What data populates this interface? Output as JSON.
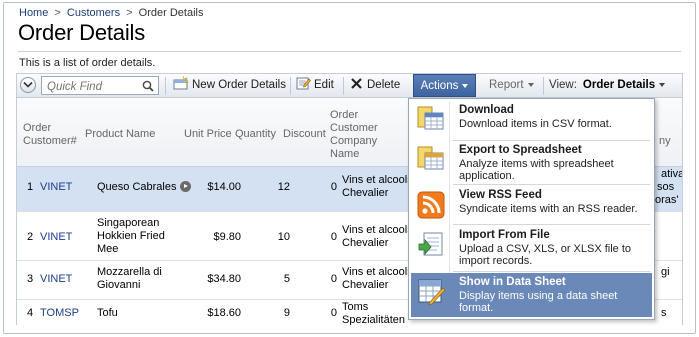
{
  "breadcrumb": {
    "home": "Home",
    "sep1": ">",
    "customers": "Customers",
    "sep2": ">",
    "current": "Order Details"
  },
  "page": {
    "title": "Order Details",
    "description": "This is a list of order details."
  },
  "toolbar": {
    "quick_find_placeholder": "Quick Find",
    "new_label": "New Order Details",
    "edit_label": "Edit",
    "delete_label": "Delete",
    "actions_label": "Actions",
    "report_label": "Report",
    "view_label": "View:",
    "view_value": "Order Details"
  },
  "columns": {
    "order_customer": "Order Customer#",
    "product_name": "Product Name",
    "unit_price": "Unit Price",
    "quantity": "Quantity",
    "discount": "Discount",
    "company_name": "Order Customer Company Name"
  },
  "rows": [
    {
      "num": "1",
      "customer": "VINET",
      "product": "Queso Cabrales",
      "price": "$14.00",
      "qty": "12",
      "discount": "0",
      "company": "Vins et alcools Chevalier",
      "trunc1": "ativa",
      "trunc2": "sos",
      "trunc3": "oras'"
    },
    {
      "num": "2",
      "customer": "VINET",
      "product": "Singaporean Hokkien Fried Mee",
      "price": "$9.80",
      "qty": "10",
      "discount": "0",
      "company": "Vins et alcools Chevalier",
      "trunc1": "",
      "trunc2": "",
      "trunc3": ""
    },
    {
      "num": "3",
      "customer": "VINET",
      "product": "Mozzarella di Giovanni",
      "price": "$34.80",
      "qty": "5",
      "discount": "0",
      "company": "Vins et alcools Chevalier",
      "trunc1": "gi",
      "trunc2": "",
      "trunc3": ""
    },
    {
      "num": "4",
      "customer": "TOMSP",
      "product": "Tofu",
      "price": "$18.60",
      "qty": "9",
      "discount": "0",
      "company": "Toms Spezialitäten",
      "trunc1": "s",
      "trunc2": "",
      "trunc3": ""
    }
  ],
  "header_trunc": "ny",
  "actions_menu": [
    {
      "title": "Download",
      "desc": "Download items in CSV format.",
      "icon": "download-csv-icon"
    },
    {
      "title": "Export to Spreadsheet",
      "desc": "Analyze items with spreadsheet application.",
      "icon": "spreadsheet-icon"
    },
    {
      "title": "View RSS Feed",
      "desc": "Syndicate items with an RSS reader.",
      "icon": "rss-icon"
    },
    {
      "title": "Import From File",
      "desc": "Upload a CSV, XLS, or XLSX file to import records.",
      "icon": "import-file-icon"
    },
    {
      "title": "Show in Data Sheet",
      "desc": "Display items using a data sheet format.",
      "icon": "data-sheet-icon"
    }
  ],
  "colors": {
    "accent": "#3d64a0",
    "selected_row": "#d4e1f2",
    "menu_highlight": "#6a88b8",
    "rss": "#f07a1c"
  }
}
